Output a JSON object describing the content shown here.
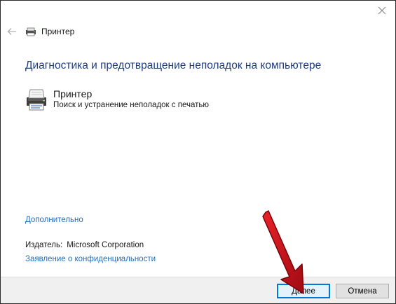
{
  "window": {
    "title": "Принтер"
  },
  "main": {
    "heading": "Диагностика и предотвращение неполадок на компьютере",
    "troubleshooter": {
      "name": "Принтер",
      "description": "Поиск и устранение неполадок с печатью"
    },
    "advanced_link": "Дополнительно",
    "publisher_label": "Издатель:",
    "publisher_value": "Microsoft Corporation",
    "privacy_link": "Заявление о конфиденциальности"
  },
  "footer": {
    "next_label": "Далее",
    "cancel_label": "Отмена"
  },
  "colors": {
    "heading": "#1e3d85",
    "link": "#1f6fbf",
    "focus_border": "#0078d7",
    "annotation_arrow": "#c8101a"
  },
  "icons": [
    "close-icon",
    "back-arrow-icon",
    "printer-icon"
  ]
}
